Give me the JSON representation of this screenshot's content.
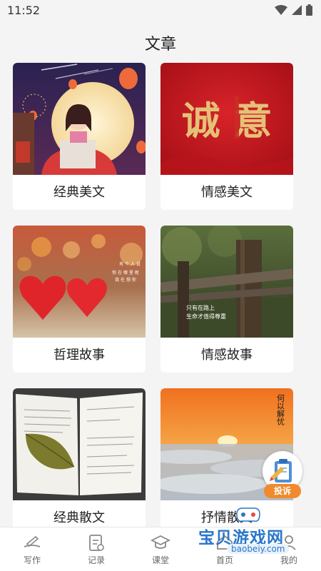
{
  "status": {
    "time": "11:52"
  },
  "page": {
    "title": "文章"
  },
  "cards": [
    {
      "label": "经典美文"
    },
    {
      "label": "情感美文",
      "image_text": "诚 意"
    },
    {
      "label": "哲理故事",
      "image_text_1": "有 个 人 说",
      "image_text_2": "你 在 哪 里 呢",
      "image_text_3": "我 在 想 你"
    },
    {
      "label": "情感故事",
      "image_text_1": "只有在路上",
      "image_text_2": "生命才值得尊重"
    },
    {
      "label": "经典散文"
    },
    {
      "label": "抒情散文",
      "image_text": "何以解忧"
    }
  ],
  "fab": {
    "label": "投诉"
  },
  "tabs": [
    {
      "label": "写作"
    },
    {
      "label": "记录"
    },
    {
      "label": "课堂"
    },
    {
      "label": "首页"
    },
    {
      "label": "我的"
    }
  ],
  "watermark": {
    "title": "宝贝游戏网",
    "url": "baobeiy.com"
  },
  "colors": {
    "accent": "#f08a2c",
    "watermark": "#2a77c9"
  }
}
